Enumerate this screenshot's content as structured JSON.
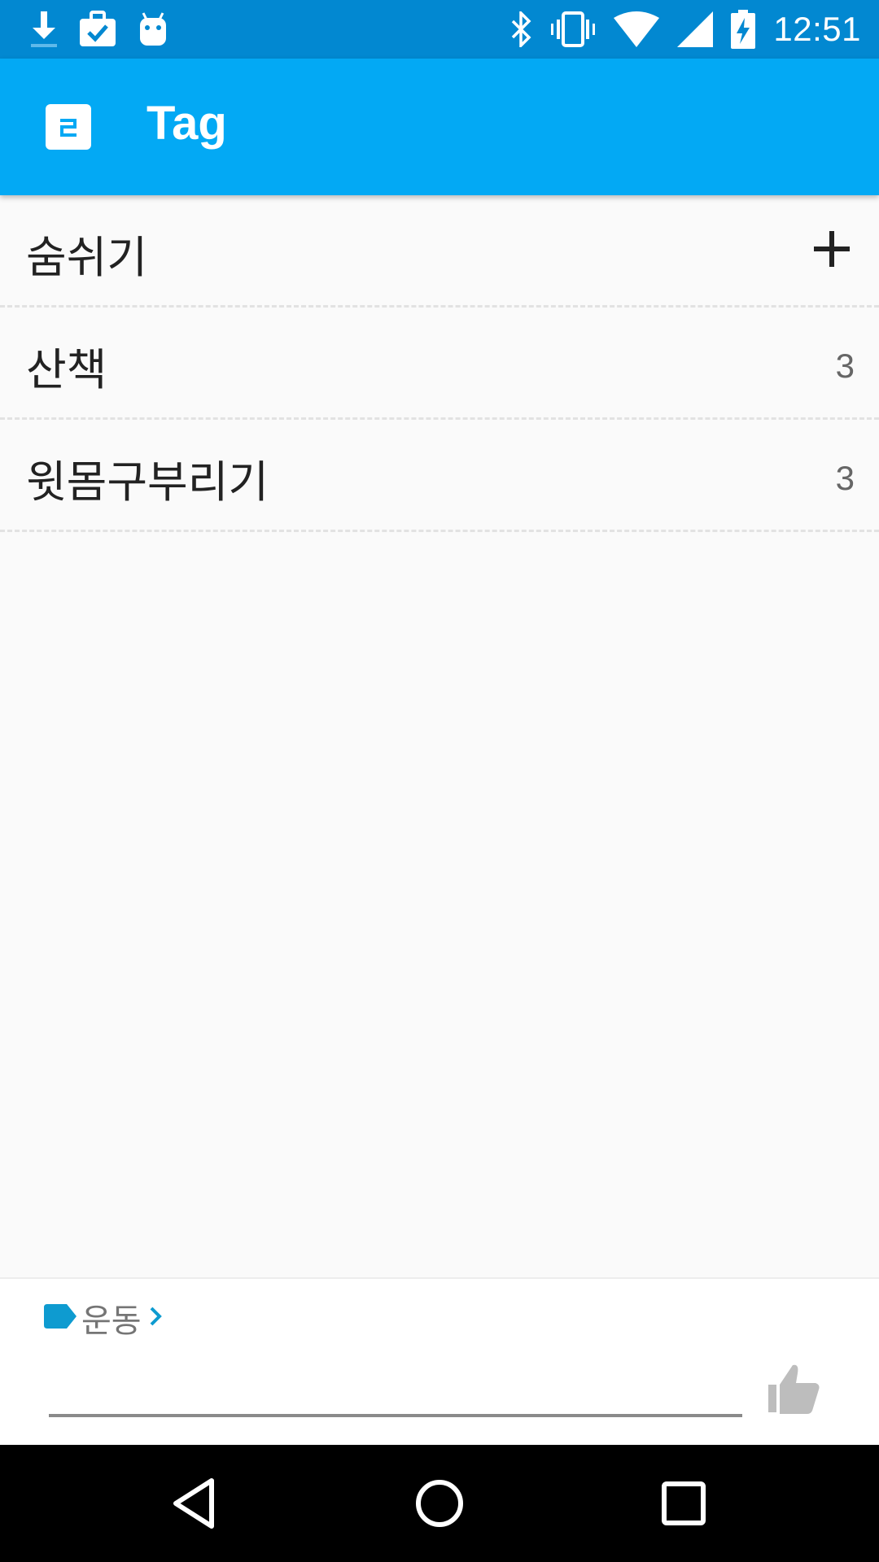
{
  "status_bar": {
    "time": "12:51",
    "icons": [
      "download-icon",
      "briefcase-check-icon",
      "android-icon",
      "bluetooth-icon",
      "vibrate-icon",
      "wifi-icon",
      "cell-signal-icon",
      "battery-charging-icon"
    ]
  },
  "app_bar": {
    "app_icon_glyph": "2",
    "title": "Tag"
  },
  "tags": [
    {
      "name": "숨쉬기",
      "action": "plus-icon"
    },
    {
      "name": "산책",
      "count": "3"
    },
    {
      "name": "윗몸구부리기",
      "count": "3"
    }
  ],
  "bottom_panel": {
    "category_label": "운동",
    "category_color": "#0e9bd0",
    "input_value": "",
    "like_icon": "thumbs-up-icon"
  },
  "nav_bar": {
    "buttons": [
      "back-icon",
      "home-icon",
      "recents-icon"
    ]
  },
  "colors": {
    "status_bar": "#0288d1",
    "app_bar": "#03a9f4",
    "background": "#fafafa"
  }
}
